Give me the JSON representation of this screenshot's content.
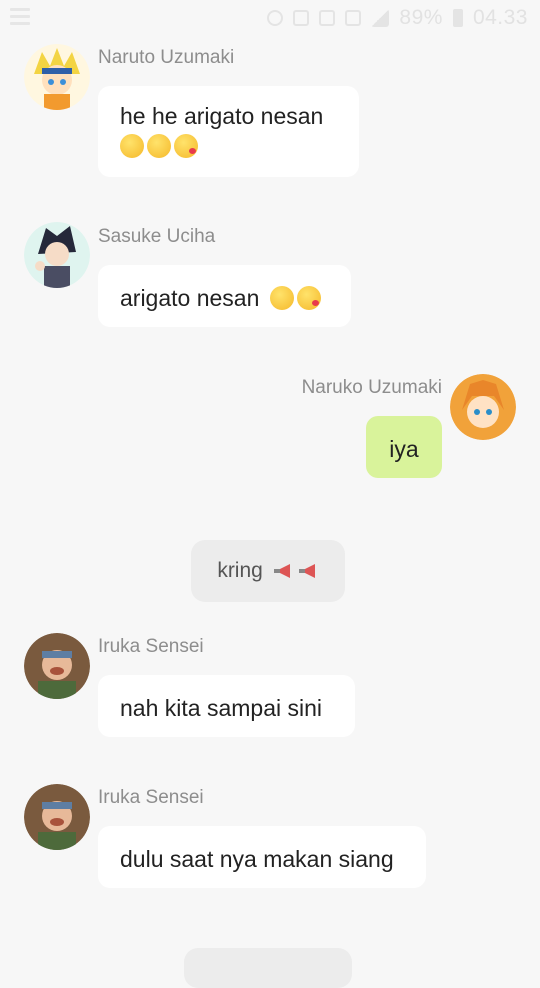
{
  "status_bar": {
    "battery": "89%",
    "time": "04.33"
  },
  "messages": [
    {
      "sender": "Naruto Uzumaki",
      "text": "he he arigato nesan",
      "emoji": [
        "relieved-face",
        "winking-face",
        "kissing-face"
      ]
    },
    {
      "sender": "Sasuke Uciha",
      "text": "arigato nesan",
      "emoji": [
        "winking-face",
        "kissing-face"
      ]
    },
    {
      "sender": "Naruko Uzumaki",
      "text": "iya",
      "outgoing": true
    },
    {
      "system": "kring",
      "emoji": [
        "loudspeaker",
        "loudspeaker"
      ]
    },
    {
      "sender": "Iruka Sensei",
      "text": "nah kita sampai sini"
    },
    {
      "sender": "Iruka Sensei",
      "text": "dulu saat nya makan siang"
    }
  ],
  "colors": {
    "outgoing_bubble": "#d9f39b",
    "incoming_bubble": "#ffffff",
    "background": "#f7f7f7"
  }
}
